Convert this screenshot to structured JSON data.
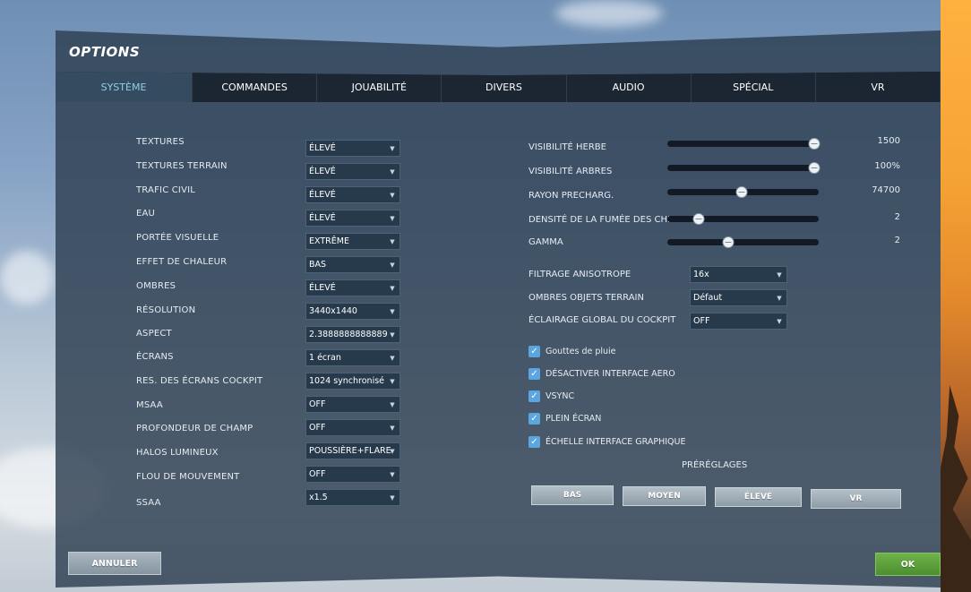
{
  "window": {
    "title": "OPTIONS"
  },
  "tabs": [
    {
      "label": "SYSTÈME",
      "active": true
    },
    {
      "label": "COMMANDES",
      "active": false
    },
    {
      "label": "JOUABILITÉ",
      "active": false
    },
    {
      "label": "DIVERS",
      "active": false
    },
    {
      "label": "AUDIO",
      "active": false
    },
    {
      "label": "SPÉCIAL",
      "active": false
    },
    {
      "label": "VR",
      "active": false
    }
  ],
  "system_settings": [
    {
      "label": "TEXTURES",
      "value": "ÉLEVÉ"
    },
    {
      "label": "TEXTURES TERRAIN",
      "value": "ÉLEVÉ"
    },
    {
      "label": "TRAFIC CIVIL",
      "value": "ÉLEVÉ"
    },
    {
      "label": "EAU",
      "value": "ÉLEVÉ"
    },
    {
      "label": "PORTÉE VISUELLE",
      "value": "EXTRÊME"
    },
    {
      "label": "EFFET DE CHALEUR",
      "value": "BAS"
    },
    {
      "label": "OMBRES",
      "value": "ÉLEVÉ"
    },
    {
      "label": "RÉSOLUTION",
      "value": "3440x1440"
    },
    {
      "label": "ASPECT",
      "value": "2.3888888888889"
    },
    {
      "label": "ÉCRANS",
      "value": "1 écran"
    },
    {
      "label": "RES. DES ÉCRANS COCKPIT",
      "value": "1024 synchronisé"
    },
    {
      "label": "MSAA",
      "value": "OFF"
    },
    {
      "label": "PROFONDEUR DE CHAMP",
      "value": "OFF"
    },
    {
      "label": "HALOS LUMINEUX",
      "value": "POUSSIÈRE+FLARE"
    },
    {
      "label": "FLOU DE MOUVEMENT",
      "value": "OFF"
    },
    {
      "label": "SSAA",
      "value": "x1.5"
    }
  ],
  "sliders": [
    {
      "label": "VISIBILITÉ HERBE",
      "value": "1500",
      "level": 0.97
    },
    {
      "label": "VISIBILITÉ ARBRES",
      "value": "100%",
      "level": 0.97
    },
    {
      "label": "RAYON PRECHARG.",
      "value": "74700",
      "level": 0.49
    },
    {
      "label": "DENSITÉ DE LA FUMÉE DES CHI",
      "value": "2",
      "level": 0.21
    },
    {
      "label": "GAMMA",
      "value": "2",
      "level": 0.4
    }
  ],
  "right_dropdowns": [
    {
      "label": "FILTRAGE ANISOTROPE",
      "value": "16x"
    },
    {
      "label": "OMBRES OBJETS TERRAIN",
      "value": "Défaut"
    },
    {
      "label": "ÉCLAIRAGE GLOBAL DU COCKPIT",
      "value": "OFF"
    }
  ],
  "checkboxes": [
    {
      "label": "Gouttes de pluie",
      "checked": true
    },
    {
      "label": "DÉSACTIVER INTERFACE AERO",
      "checked": true
    },
    {
      "label": "VSYNC",
      "checked": true
    },
    {
      "label": "PLEIN ÉCRAN",
      "checked": true
    },
    {
      "label": "ÉCHELLE INTERFACE GRAPHIQUE",
      "checked": true
    }
  ],
  "presets": {
    "title": "PRÉRÉGLAGES",
    "buttons": [
      "BAS",
      "MOYEN",
      "ÉLEVÉ",
      "VR"
    ]
  },
  "footer": {
    "cancel_label": "ANNULER",
    "ok_label": "OK"
  },
  "icons": {
    "dropdown_arrow": "chevron-down-icon",
    "checkbox": "checkmark-icon",
    "check_glyph": "✓",
    "arrow_glyph": "▼"
  },
  "colors": {
    "active_tab_text": "#8fd0ea",
    "checkbox": "#5ba6e0",
    "ok_button": "#5aa13a"
  }
}
